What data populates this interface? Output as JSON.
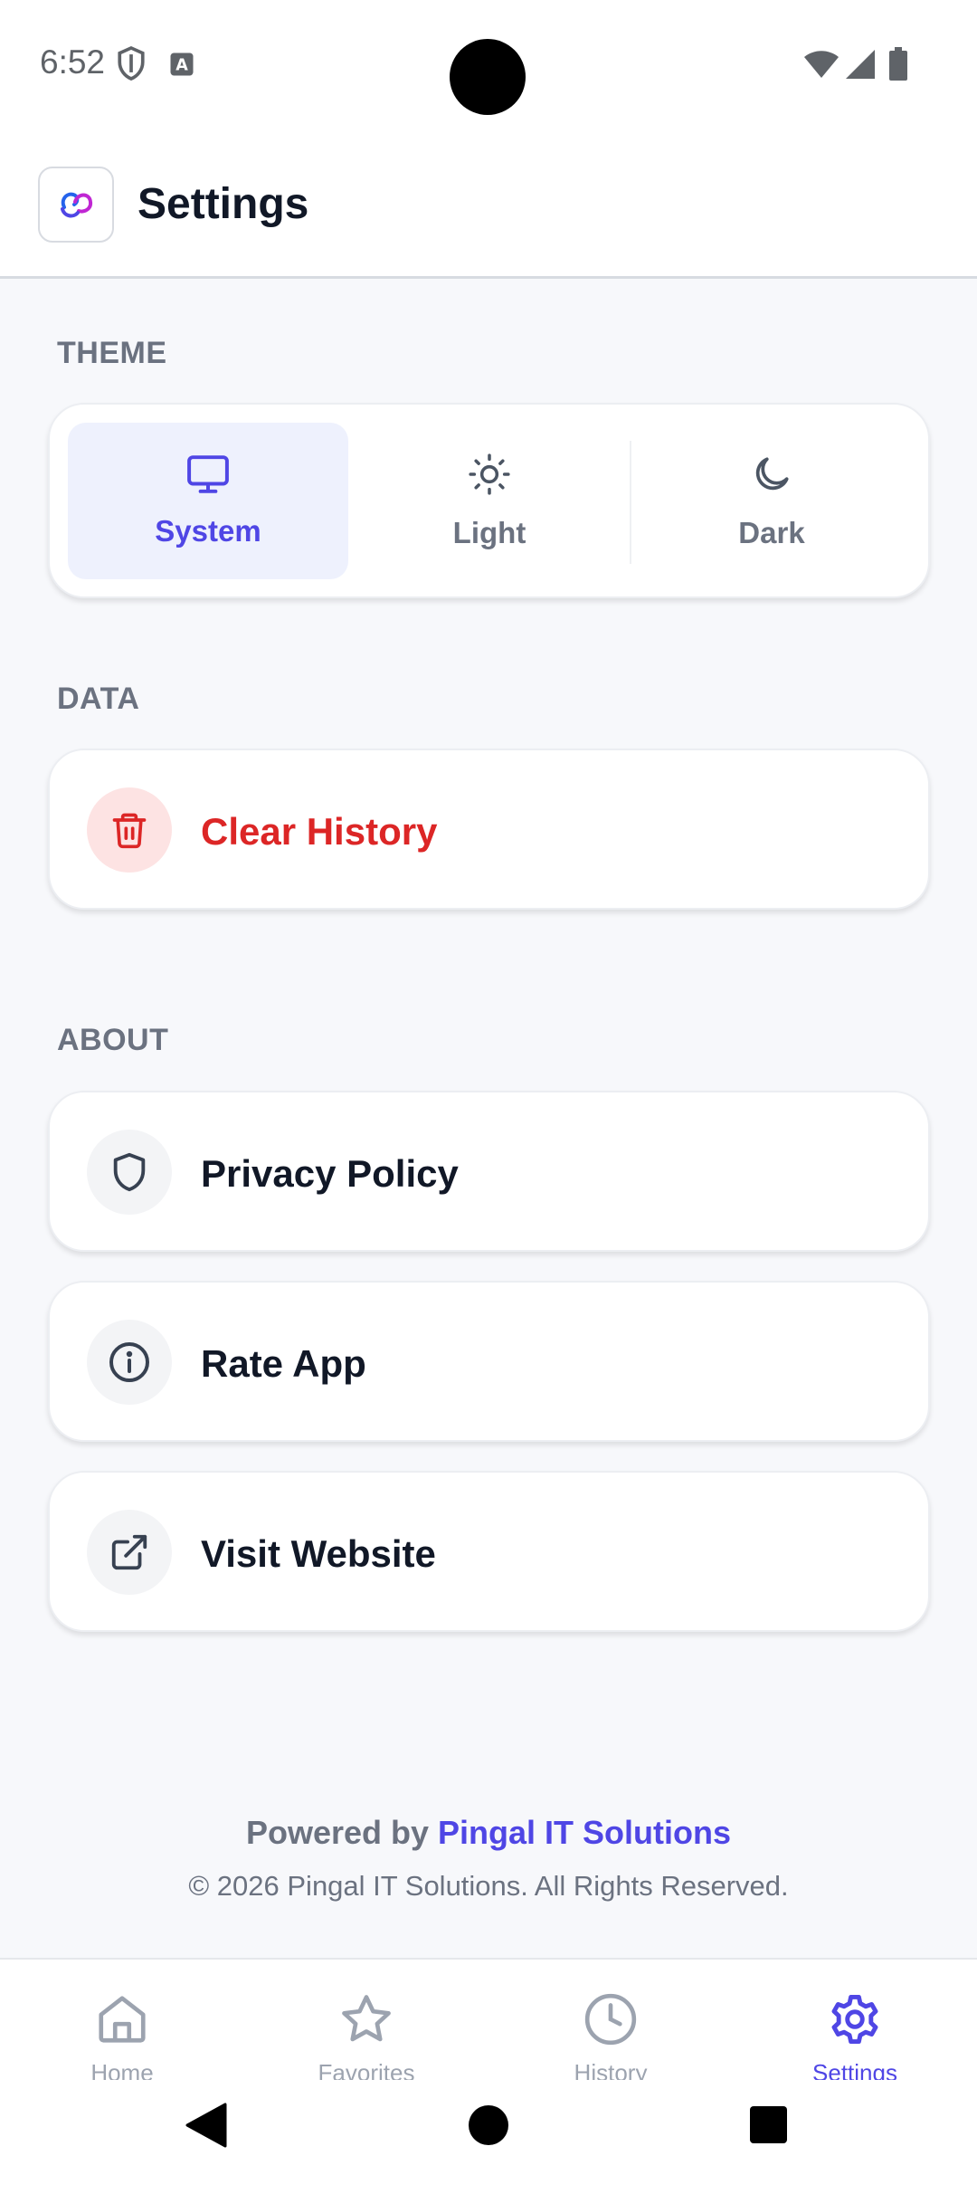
{
  "status_bar": {
    "time": "6:52",
    "left_icons": [
      "shield-status-icon",
      "keyboard-a-icon"
    ],
    "right_icons": [
      "wifi-icon",
      "cell-signal-icon",
      "battery-icon"
    ]
  },
  "header": {
    "logo_icon": "app-logo-icon",
    "title": "Settings"
  },
  "theme": {
    "section_label": "THEME",
    "options": [
      {
        "label": "System",
        "icon": "monitor-icon",
        "selected": true
      },
      {
        "label": "Light",
        "icon": "sun-icon",
        "selected": false
      },
      {
        "label": "Dark",
        "icon": "moon-icon",
        "selected": false
      }
    ]
  },
  "data_section": {
    "section_label": "DATA",
    "clear_history": {
      "label": "Clear History",
      "icon": "trash-icon"
    }
  },
  "about_section": {
    "section_label": "ABOUT",
    "items": [
      {
        "label": "Privacy Policy",
        "icon": "shield-icon"
      },
      {
        "label": "Rate App",
        "icon": "info-icon"
      },
      {
        "label": "Visit Website",
        "icon": "external-link-icon"
      }
    ]
  },
  "footer": {
    "powered_prefix": "Powered by",
    "brand": "Pingal IT Solutions",
    "copyright": "© 2026 Pingal IT Solutions. All Rights Reserved."
  },
  "bottom_nav": {
    "items": [
      {
        "label": "Home",
        "icon": "home-icon",
        "active": false
      },
      {
        "label": "Favorites",
        "icon": "star-icon",
        "active": false
      },
      {
        "label": "History",
        "icon": "clock-icon",
        "active": false
      },
      {
        "label": "Settings",
        "icon": "gear-icon",
        "active": true
      }
    ]
  },
  "colors": {
    "accent": "#4f46e5",
    "danger": "#dc2626",
    "selected_bg": "#eef1fd",
    "muted": "#6b7280",
    "background": "#f7f8fb"
  }
}
